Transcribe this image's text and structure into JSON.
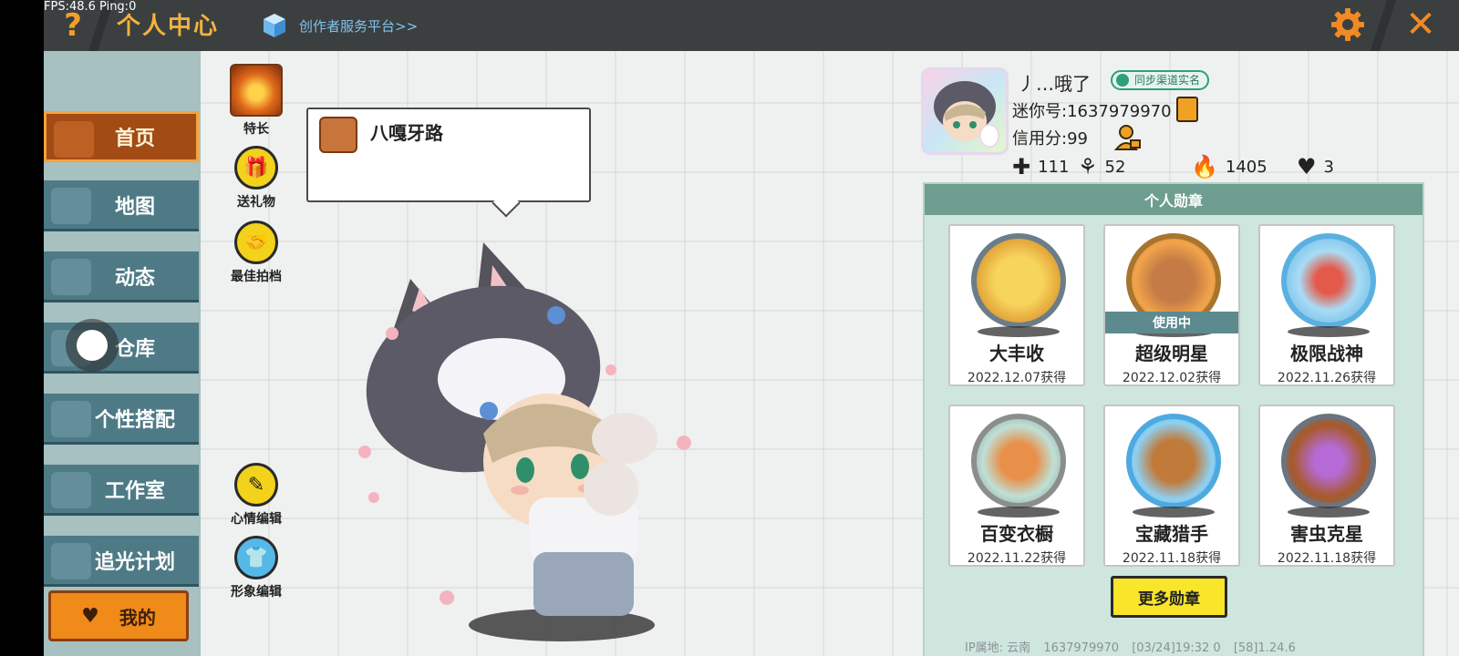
{
  "overlay": {
    "fps": "FPS:48.6  Ping:0"
  },
  "header": {
    "help_label": "?",
    "title": "个人中心",
    "creator_link": "创作者服务平台>>",
    "close_label": "✕"
  },
  "sidebar": {
    "items": [
      {
        "label": "首页",
        "active": true
      },
      {
        "label": "地图"
      },
      {
        "label": "动态"
      },
      {
        "label": "仓库"
      },
      {
        "label": "个性搭配"
      },
      {
        "label": "工作室"
      },
      {
        "label": "追光计划"
      }
    ],
    "mine_label": "我的"
  },
  "actions": {
    "skill": "特长",
    "gift": "送礼物",
    "partner": "最佳拍档",
    "mood_edit": "心情编辑",
    "look_edit": "形象编辑"
  },
  "mood": {
    "text": "八嘎牙路"
  },
  "profile": {
    "nickname": "丿…哦了",
    "sync_badge": "同步渠道实名",
    "mini_id": "迷你号:1637979970",
    "credit": "信用分:99",
    "stats": [
      {
        "icon": "plus-box-icon",
        "value": "111"
      },
      {
        "icon": "cheer-icon",
        "value": "52"
      },
      {
        "icon": "flame-icon",
        "value": "1405"
      },
      {
        "icon": "hearts-icon",
        "value": "3"
      }
    ]
  },
  "medals": {
    "title": "个人勋章",
    "items": [
      {
        "name": "大丰收",
        "date": "2022.12.07获得",
        "ring": "#6b7d88",
        "fill": "#f0c23a",
        "using": false
      },
      {
        "name": "超级明星",
        "date": "2022.12.02获得",
        "ring": "#a8752e",
        "fill": "#f2a44a",
        "using": true,
        "using_label": "使用中"
      },
      {
        "name": "极限战神",
        "date": "2022.11.26获得",
        "ring": "#5ab0e0",
        "fill": "#a9dcf5",
        "using": false
      },
      {
        "name": "百变衣橱",
        "date": "2022.11.22获得",
        "ring": "#8a8f8c",
        "fill": "#bfe0d7",
        "using": false
      },
      {
        "name": "宝藏猎手",
        "date": "2022.11.18获得",
        "ring": "#4ea9e0",
        "fill": "#c07a3a",
        "using": false
      },
      {
        "name": "害虫克星",
        "date": "2022.11.18获得",
        "ring": "#6b7480",
        "fill": "#a85a2c",
        "using": false
      }
    ],
    "more_label": "更多勋章"
  },
  "footer": {
    "ip": "IP属地: 云南",
    "uid": "1637979970",
    "time": "[03/24]19:32 0",
    "version": "[58]1.24.6"
  },
  "colors": {
    "accent_orange": "#f4a23c",
    "sidebar_blue": "#4e7a86",
    "medal_header": "#6e9e8f",
    "yellow_button": "#f9e52a"
  }
}
